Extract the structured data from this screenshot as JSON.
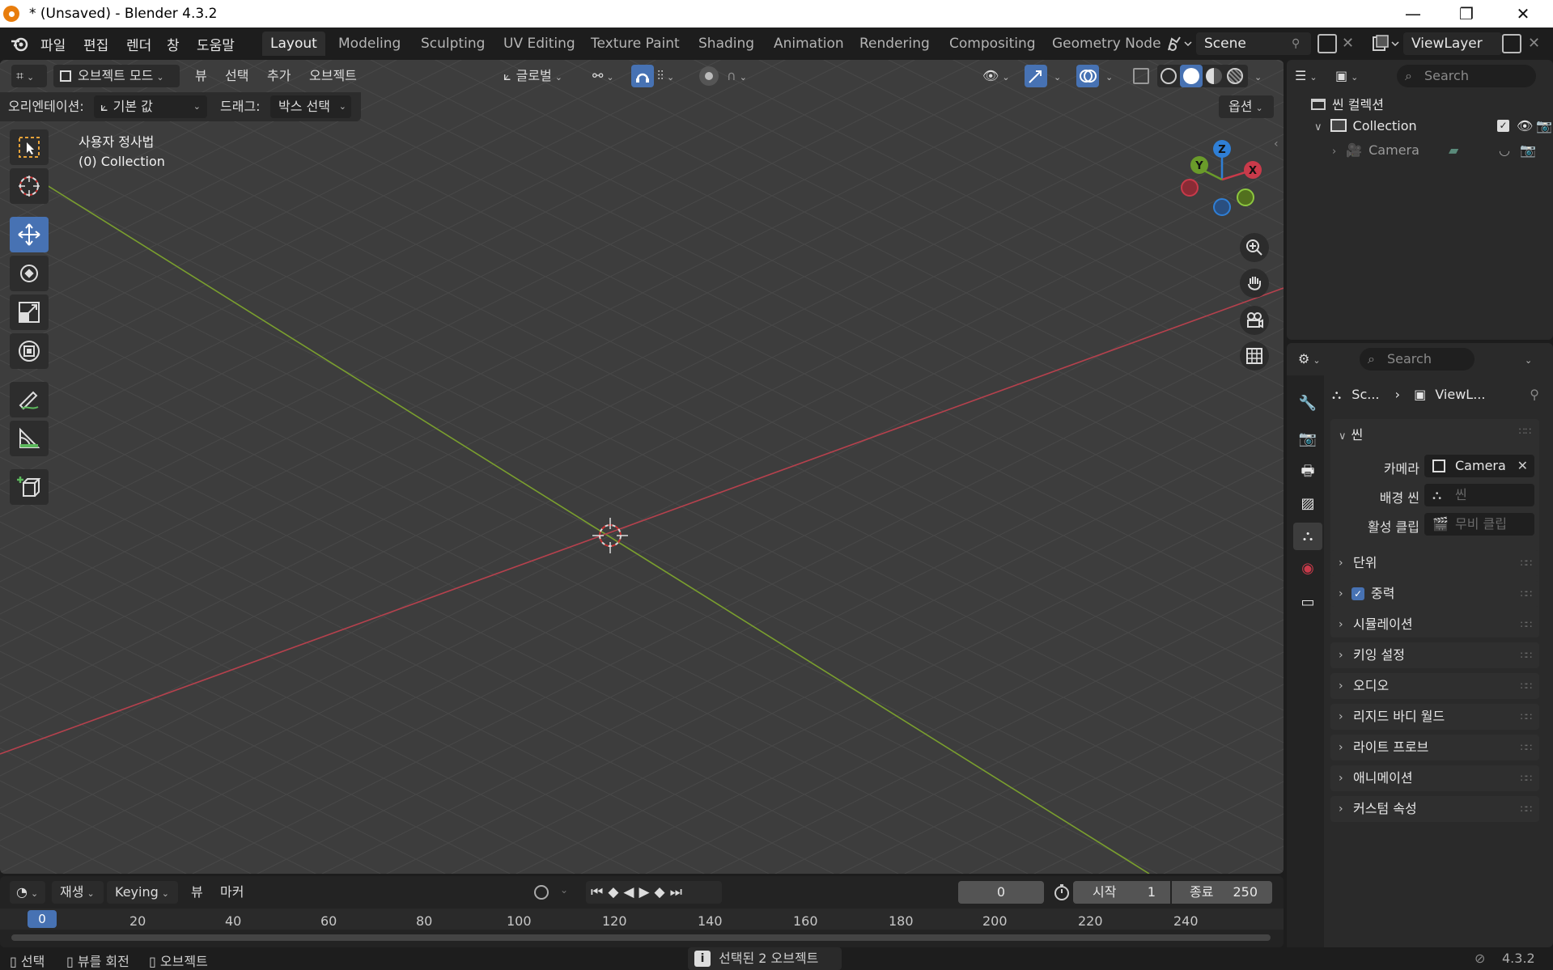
{
  "window": {
    "title": "* (Unsaved) - Blender 4.3.2",
    "minimize_glyph": "—",
    "maximize_glyph": "❐",
    "close_glyph": "✕"
  },
  "menu": {
    "items": [
      "파일",
      "편집",
      "렌더",
      "창",
      "도움말"
    ]
  },
  "workspaces": {
    "tabs": [
      "Layout",
      "Modeling",
      "Sculpting",
      "UV Editing",
      "Texture Paint",
      "Shading",
      "Animation",
      "Rendering",
      "Compositing",
      "Geometry Node"
    ],
    "active": "Layout"
  },
  "scene_selector": {
    "value": "Scene"
  },
  "viewlayer_selector": {
    "value": "ViewLayer"
  },
  "viewport_header": {
    "mode": "오브젝트 모드",
    "menus": [
      "뷰",
      "선택",
      "추가",
      "오브젝트"
    ],
    "transform_orientation": "글로벌",
    "options": "옵션"
  },
  "tool_settings": {
    "orientation_label": "오리엔테이션:",
    "orientation_value": "기본 값",
    "drag_label": "드래그:",
    "drag_value": "박스 선택"
  },
  "viewport_overlay": {
    "view_name": "사용자 정사법",
    "collection": "(0) Collection"
  },
  "gizmo": {
    "x": "X",
    "y": "Y",
    "z": "Z"
  },
  "timeline": {
    "menus": [
      "재생",
      "Keying",
      "뷰",
      "마커"
    ],
    "current_frame": "0",
    "start_label": "시작",
    "start_value": "1",
    "end_label": "종료",
    "end_value": "250",
    "ruler": [
      "0",
      "20",
      "40",
      "60",
      "80",
      "100",
      "120",
      "140",
      "160",
      "180",
      "200",
      "220",
      "240"
    ]
  },
  "status_bar": {
    "select": "선택",
    "rotate_view": "뷰를 회전",
    "object": "오브젝트",
    "message": "선택된 2 오브젝트",
    "version": "4.3.2"
  },
  "outliner": {
    "search_placeholder": "Search",
    "scene_collection": "씬 컬렉션",
    "collection": "Collection",
    "camera": "Camera"
  },
  "properties": {
    "search_placeholder": "Search",
    "breadcrumb_scene": "Sc...",
    "breadcrumb_viewlayer": "ViewL...",
    "panel_title": "씬",
    "camera_label": "카메라",
    "camera_value": "Camera",
    "background_label": "배경 씬",
    "background_placeholder": "씬",
    "clip_label": "활성 클립",
    "clip_placeholder": "무비 클립",
    "subpanels": [
      "단위",
      "중력",
      "시뮬레이션",
      "키잉 설정",
      "오디오",
      "리지드 바디 월드",
      "라이트 프로브",
      "애니메이션",
      "커스텀 속성"
    ]
  },
  "colors": {
    "accent_blue": "#4772b3",
    "axis_x": "#c93a4a",
    "axis_y": "#6a9b2a",
    "axis_z": "#2f7fd6",
    "viewport_bg": "#3d3d3d"
  }
}
